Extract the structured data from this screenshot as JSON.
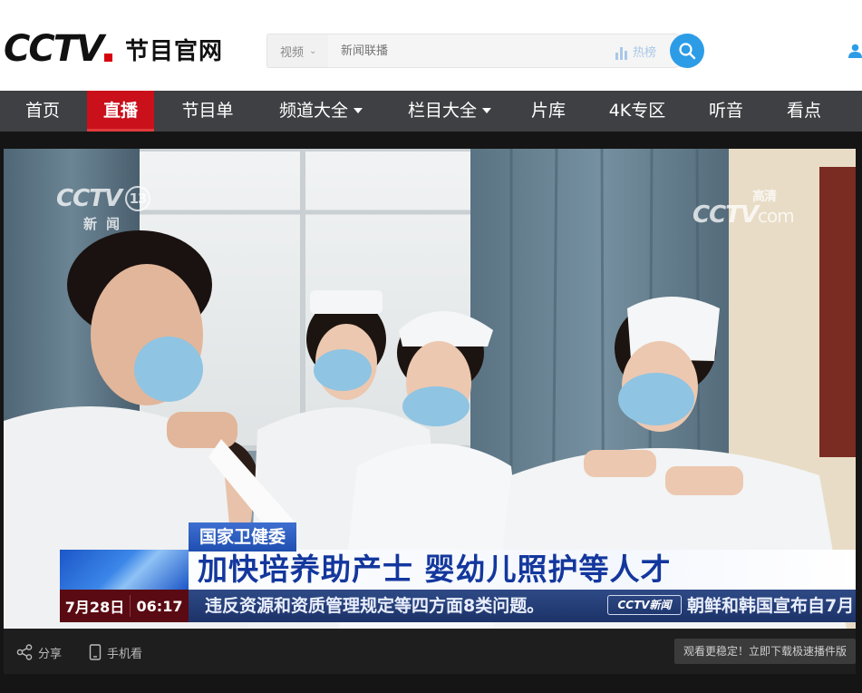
{
  "header": {
    "logo_text": "CCTV",
    "logo_sub": "节目官网"
  },
  "search": {
    "category": "视频",
    "placeholder": "新闻联播",
    "hot_label": "热榜"
  },
  "nav": {
    "items": [
      {
        "label": "首页"
      },
      {
        "label": "直播",
        "active": true
      },
      {
        "label": "节目单"
      },
      {
        "label": "频道大全",
        "dropdown": true
      },
      {
        "label": "栏目大全",
        "dropdown": true
      },
      {
        "label": "片库"
      },
      {
        "label": "4K专区"
      },
      {
        "label": "听音"
      },
      {
        "label": "看点"
      }
    ]
  },
  "video": {
    "watermark_left": "CCTV",
    "watermark_left_channel": "13",
    "watermark_left_sub": "新闻",
    "watermark_right": "CCTV",
    "watermark_right_suffix": "com",
    "watermark_right_hd": "高清",
    "caption_org": "国家卫健委",
    "caption_main": "加快培养助产士 婴幼儿照护等人才",
    "ticker_date": "7月28日",
    "ticker_time": "06:17",
    "ticker_text": "违反资源和资质管理规定等四方面8类问题。",
    "ticker_logo": "CCTV新闻",
    "ticker_text2": "朝鲜和韩国宣布自7月"
  },
  "bottom_bar": {
    "share_label": "分享",
    "mobile_label": "手机看",
    "promo_text": "观看更稳定！立即下载极速播件版"
  },
  "colors": {
    "nav_bg": "#3f4043",
    "nav_active": "#c9101b",
    "search_button": "#2d9ce6",
    "caption_text": "#13379d"
  }
}
